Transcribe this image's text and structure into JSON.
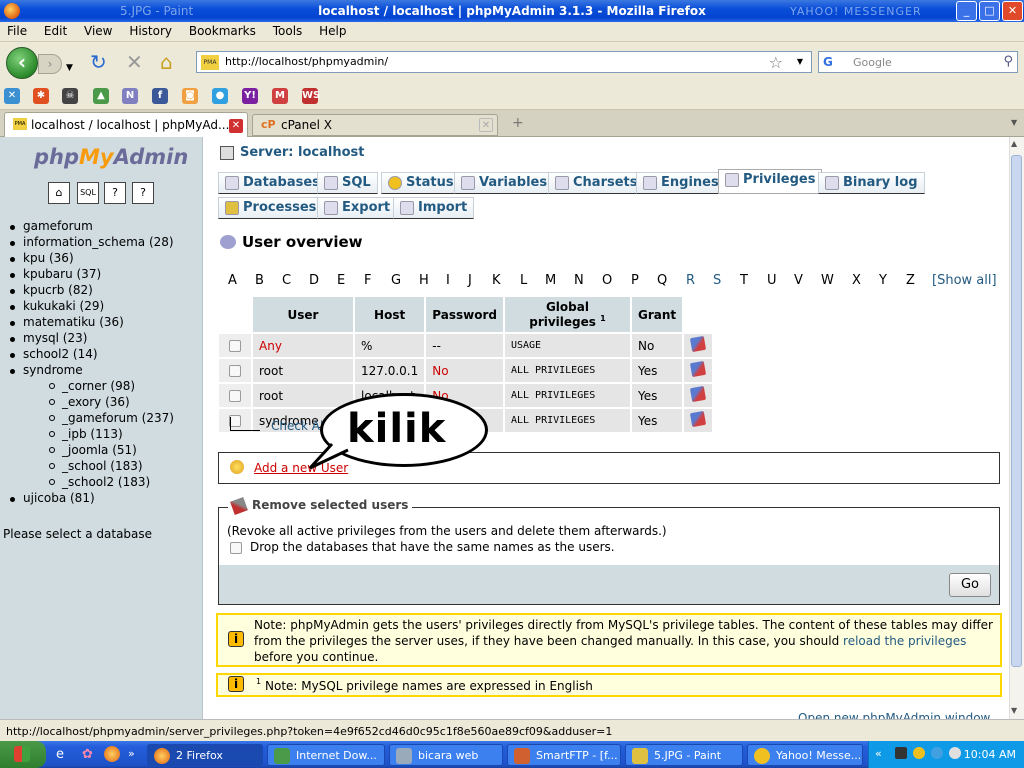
{
  "window": {
    "title": "localhost / localhost | phpMyAdmin 3.1.3 - Mozilla Firefox",
    "ghost_left": "5.JPG - Paint",
    "ghost_right": "YAHOO! MESSENGER"
  },
  "menu": [
    "File",
    "Edit",
    "View",
    "History",
    "Bookmarks",
    "Tools",
    "Help"
  ],
  "address_bar": {
    "url": "http://localhost/phpmyadmin/"
  },
  "search_bar": {
    "placeholder": "Google"
  },
  "tabs": [
    {
      "label": "localhost / localhost | phpMyAd..."
    },
    {
      "label": "cPanel X"
    }
  ],
  "sidebar": {
    "logo": {
      "php": "php",
      "my": "My",
      "admin": "Admin"
    },
    "databases": [
      {
        "name": "gameforum"
      },
      {
        "name": "information_schema (28)"
      },
      {
        "name": "kpu (36)"
      },
      {
        "name": "kpubaru (37)"
      },
      {
        "name": "kpucrb (82)"
      },
      {
        "name": "kukukaki (29)"
      },
      {
        "name": "matematiku (36)"
      },
      {
        "name": "mysql (23)"
      },
      {
        "name": "school2 (14)"
      },
      {
        "name": "syndrome"
      },
      {
        "name": "ujicoba (81)"
      }
    ],
    "syndrome_children": [
      "_corner (98)",
      "_exory (36)",
      "_gameforum (237)",
      "_ipb (113)",
      "_joomla (51)",
      "_school (183)",
      "_school2 (183)"
    ],
    "hint": "Please select a database"
  },
  "main": {
    "server_label": "Server: localhost",
    "tabs_row1": [
      "Databases",
      "SQL",
      "Status",
      "Variables",
      "Charsets",
      "Engines",
      "Privileges",
      "Binary log"
    ],
    "tabs_row2": [
      "Processes",
      "Export",
      "Import"
    ],
    "heading": "User overview",
    "letters": [
      "A",
      "B",
      "C",
      "D",
      "E",
      "F",
      "G",
      "H",
      "I",
      "J",
      "K",
      "L",
      "M",
      "N",
      "O",
      "P",
      "Q",
      "R",
      "S",
      "T",
      "U",
      "V",
      "W",
      "X",
      "Y",
      "Z"
    ],
    "show_all": "[Show all]",
    "table": {
      "headers": [
        "User",
        "Host",
        "Password",
        "Global privileges",
        "Grant"
      ],
      "footnote_mark": "1",
      "rows": [
        {
          "user": "Any",
          "host": "%",
          "password": "--",
          "privileges": "USAGE",
          "grant": "No"
        },
        {
          "user": "root",
          "host": "127.0.0.1",
          "password": "No",
          "privileges": "ALL PRIVILEGES",
          "grant": "Yes"
        },
        {
          "user": "root",
          "host": "localhost",
          "password": "No",
          "privileges": "ALL PRIVILEGES",
          "grant": "Yes"
        },
        {
          "user": "syndrome_one",
          "host": "",
          "password": "",
          "privileges": "ALL PRIVILEGES",
          "grant": "Yes"
        }
      ]
    },
    "check_all": "Check All",
    "add_user": "Add a new User",
    "bubble_text": "kilik",
    "remove_legend": "Remove selected users",
    "revoke_text": "(Revoke all active privileges from the users and delete them afterwards.)",
    "drop_label": "Drop the databases that have the same names as the users.",
    "go_button": "Go",
    "note1": {
      "before": "Note: phpMyAdmin gets the users' privileges directly from MySQL's privilege tables. The content of these tables may differ from the privileges the server uses, if they have been changed manually. In this case, you should ",
      "link": "reload the privileges",
      "after": " before you continue."
    },
    "note2": {
      "sup": "1",
      "text": "Note: MySQL privilege names are expressed in English"
    },
    "open_new": "Open new phpMyAdmin window"
  },
  "statusbar": {
    "text": "http://localhost/phpmyadmin/server_privileges.php?token=4e9f652cd46d0c95c1f8e560ae89cf09&adduser=1"
  },
  "taskbar": {
    "items": [
      "2 Firefox",
      "Internet Dow...",
      "bicara web",
      "SmartFTP - [f...",
      "5.JPG - Paint",
      "Yahoo! Messe..."
    ],
    "clock": "10:04 AM"
  },
  "colors": {
    "pma_blue": "#235a81",
    "red": "#cc0000",
    "note_border": "#ffd700"
  }
}
